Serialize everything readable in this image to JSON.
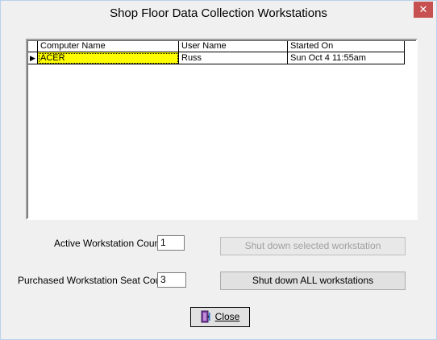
{
  "window": {
    "title": "Shop Floor Data Collection Workstations",
    "close_glyph": "✕"
  },
  "grid": {
    "columns": [
      "Computer Name",
      "User Name",
      "Started On"
    ],
    "rows": [
      {
        "computer_name": "ACER",
        "user_name": "Russ",
        "started_on": "Sun Oct 4 11:55am",
        "current": true
      }
    ],
    "current_row_indicator": "▶"
  },
  "counts": {
    "active_label": "Active Workstation Count",
    "active_value": "1",
    "purchased_label": "Purchased Workstation Seat Count",
    "purchased_value": "3"
  },
  "buttons": {
    "shutdown_selected": "Shut down selected workstation",
    "shutdown_all": "Shut down ALL workstations",
    "close_label": "Close",
    "close_icon": "door-exit-icon"
  },
  "colors": {
    "selected_cell": "#ffff00",
    "close_button_red": "#c75050"
  }
}
